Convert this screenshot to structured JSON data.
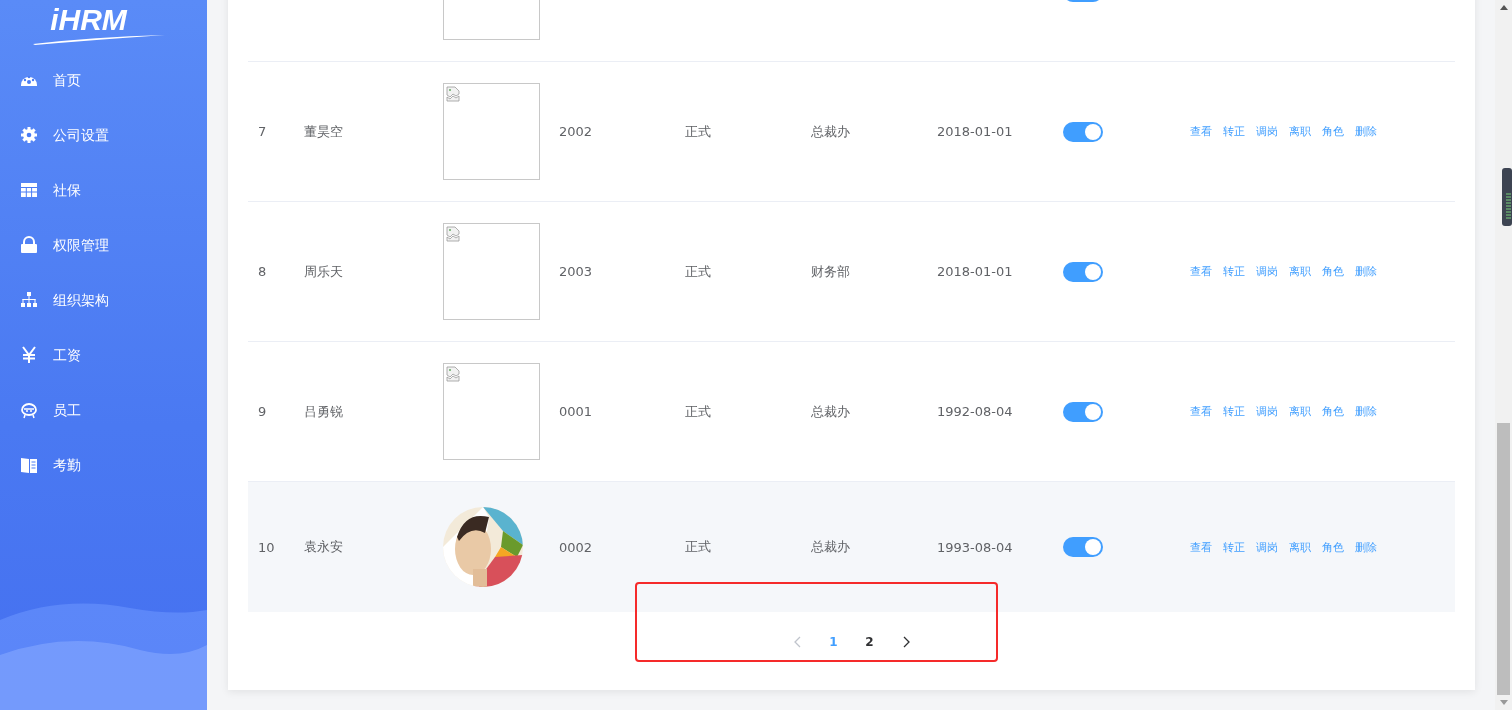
{
  "sidebar": {
    "logo": "iHRM",
    "items": [
      {
        "label": "首页",
        "kind": "dashboard"
      },
      {
        "label": "公司设置",
        "kind": "gear"
      },
      {
        "label": "社保",
        "kind": "table"
      },
      {
        "label": "权限管理",
        "kind": "lock"
      },
      {
        "label": "组织架构",
        "kind": "tree"
      },
      {
        "label": "工资",
        "kind": "yen"
      },
      {
        "label": "员工",
        "kind": "people"
      },
      {
        "label": "考勤",
        "kind": "book"
      }
    ]
  },
  "table": {
    "rows": [
      {
        "kind": "broken",
        "on": true
      },
      {
        "index": "7",
        "name": "董昊空",
        "kind": "broken",
        "work_number": "2002",
        "form": "正式",
        "department": "总裁办",
        "hire_date": "2018-01-01",
        "on": true,
        "hovered": false,
        "actions": [
          "查看",
          "转正",
          "调岗",
          "离职",
          "角色",
          "删除"
        ]
      },
      {
        "index": "8",
        "name": "周乐天",
        "kind": "broken",
        "work_number": "2003",
        "form": "正式",
        "department": "财务部",
        "hire_date": "2018-01-01",
        "on": true,
        "hovered": false,
        "actions": [
          "查看",
          "转正",
          "调岗",
          "离职",
          "角色",
          "删除"
        ]
      },
      {
        "index": "9",
        "name": "吕勇锐",
        "kind": "broken",
        "work_number": "0001",
        "form": "正式",
        "department": "总裁办",
        "hire_date": "1992-08-04",
        "on": true,
        "hovered": false,
        "actions": [
          "查看",
          "转正",
          "调岗",
          "离职",
          "角色",
          "删除"
        ]
      },
      {
        "index": "10",
        "name": "袁永安",
        "kind": "picture",
        "work_number": "0002",
        "form": "正式",
        "department": "总裁办",
        "hire_date": "1993-08-04",
        "on": true,
        "hovered": true,
        "actions": [
          "查看",
          "转正",
          "调岗",
          "离职",
          "角色",
          "删除"
        ]
      }
    ]
  },
  "pagination": {
    "prev_disabled": true,
    "next_disabled": false,
    "pages": [
      {
        "label": "1",
        "selected": true
      },
      {
        "label": "2",
        "selected": false
      }
    ]
  }
}
